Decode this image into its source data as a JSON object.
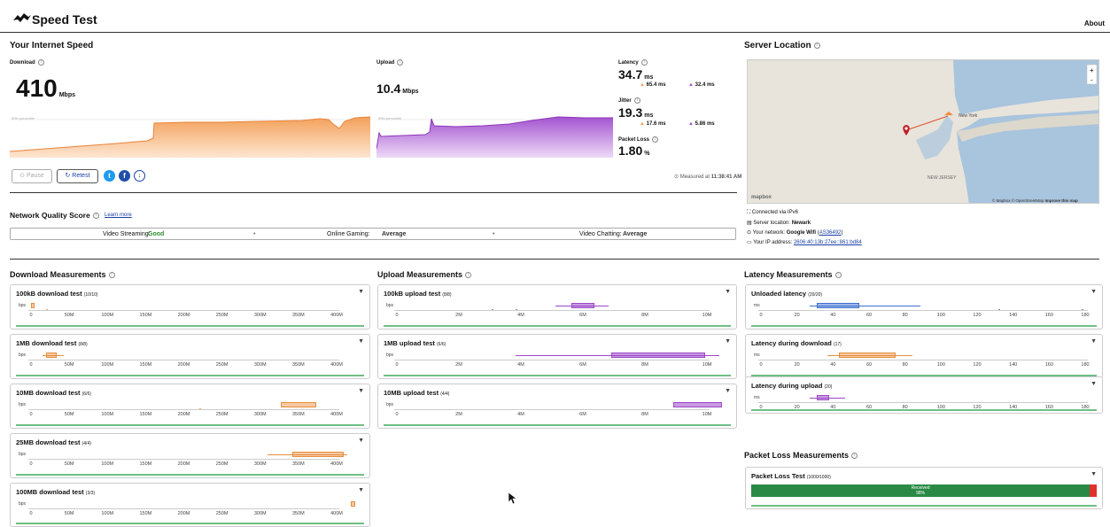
{
  "app": {
    "title": "Speed Test",
    "about": "About"
  },
  "speed": {
    "section_title": "Your Internet Speed",
    "download_label": "Download",
    "download_value": "410",
    "download_unit": "Mbps",
    "percentile_label": "90th percentile",
    "upload_label": "Upload",
    "upload_value": "10.4",
    "upload_unit": "Mbps",
    "latency_label": "Latency",
    "latency_value": "34.7",
    "latency_unit": "ms",
    "latency_down": "65.4 ms",
    "latency_up": "32.4 ms",
    "jitter_label": "Jitter",
    "jitter_value": "19.3",
    "jitter_unit": "ms",
    "jitter_down": "17.6 ms",
    "jitter_up": "5.86 ms",
    "loss_label": "Packet Loss",
    "loss_value": "1.80",
    "loss_unit": "%",
    "measured_label": "Measured at",
    "measured_time": "11:38:41 AM"
  },
  "buttons": {
    "pause": "Pause",
    "retest": "Retest"
  },
  "quality": {
    "title": "Network Quality Score",
    "learn_more": "Learn more",
    "streaming_label": "Video Streaming:",
    "streaming_value": "Good",
    "gaming_label": "Online Gaming:",
    "gaming_value": "Average",
    "chatting_label": "Video Chatting:",
    "chatting_value": "Average"
  },
  "server": {
    "title": "Server Location",
    "map_attribution": "© Mapbox © OpenStreetMap",
    "improve": "Improve this map",
    "mapbox": "mapbox",
    "city_label": "New York",
    "state_label": "NEW JERSEY",
    "connected": "Connected via IPv6",
    "location_label": "Server location:",
    "location_value": "Newark",
    "network_label": "Your network:",
    "network_value": "Google Wifi",
    "network_asn": "AS36492",
    "ip_label": "Your IP address:",
    "ip_value": "2606:40:13b:27ee::861:bd84"
  },
  "download_meas": {
    "title": "Download Measurements",
    "unit": "bps",
    "ticks": [
      "0",
      "50M",
      "100M",
      "150M",
      "200M",
      "250M",
      "300M",
      "350M",
      "400M"
    ],
    "tests": [
      {
        "name": "100kB download test",
        "count": "(10/10)"
      },
      {
        "name": "1MB download test",
        "count": "(8/8)"
      },
      {
        "name": "10MB download test",
        "count": "(6/6)"
      },
      {
        "name": "25MB download test",
        "count": "(4/4)"
      },
      {
        "name": "100MB download test",
        "count": "(3/3)"
      }
    ]
  },
  "upload_meas": {
    "title": "Upload Measurements",
    "unit": "bps",
    "ticks": [
      "0",
      "2M",
      "4M",
      "6M",
      "8M",
      "10M"
    ],
    "tests": [
      {
        "name": "100kB upload test",
        "count": "(8/8)"
      },
      {
        "name": "1MB upload test",
        "count": "(6/6)"
      },
      {
        "name": "10MB upload test",
        "count": "(4/4)"
      }
    ]
  },
  "latency_meas": {
    "title": "Latency Measurements",
    "unit": "ms",
    "ticks": [
      "0",
      "20",
      "40",
      "60",
      "80",
      "100",
      "120",
      "140",
      "160",
      "180"
    ],
    "tests": [
      {
        "name": "Unloaded latency",
        "count": "(20/20)"
      },
      {
        "name": "Latency during download",
        "count": "(17)"
      },
      {
        "name": "Latency during upload",
        "count": "(20)"
      }
    ]
  },
  "packet": {
    "title": "Packet Loss Measurements",
    "test_name": "Packet Loss Test",
    "count": "(1000/1000)",
    "received_label": "Received",
    "received_pct": "98%",
    "received_fraction": 0.98
  },
  "colors": {
    "download": "#f0a060",
    "upload": "#a453d0",
    "latency": "#3e6fcf",
    "good": "#2e8b2e",
    "received": "#2a8a45",
    "lost": "#e0302a"
  }
}
